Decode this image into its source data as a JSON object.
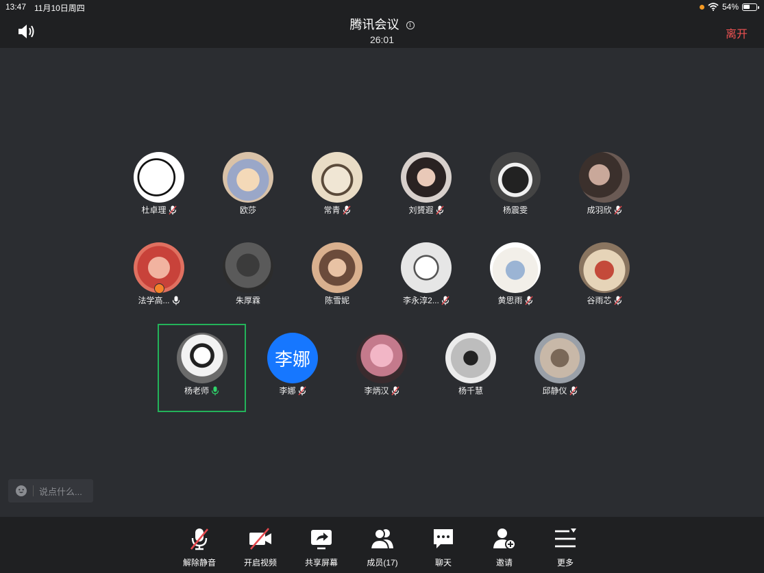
{
  "status_bar": {
    "time": "13:47",
    "date": "11月10日周四",
    "battery": "54%",
    "battery_level": 0.54
  },
  "header": {
    "title": "腾讯会议",
    "timer": "26:01",
    "leave_label": "离开"
  },
  "participants": [
    {
      "name": "杜卓理",
      "mic": "muted"
    },
    {
      "name": "欧莎",
      "mic": "none"
    },
    {
      "name": "常青",
      "mic": "muted"
    },
    {
      "name": "刘贇遐",
      "mic": "muted"
    },
    {
      "name": "杨震雯",
      "mic": "none"
    },
    {
      "name": "成羽欣",
      "mic": "muted"
    },
    {
      "name": "法学高...",
      "mic": "on",
      "host": true
    },
    {
      "name": "朱厚霖",
      "mic": "none"
    },
    {
      "name": "陈雪妮",
      "mic": "none"
    },
    {
      "name": "李永淳2...",
      "mic": "muted"
    },
    {
      "name": "黄思雨",
      "mic": "muted"
    },
    {
      "name": "谷雨芯",
      "mic": "muted"
    },
    {
      "name": "杨老师",
      "mic": "speaking",
      "active": true
    },
    {
      "name": "李娜",
      "mic": "muted",
      "initials": "李娜"
    },
    {
      "name": "李炳汉",
      "mic": "muted"
    },
    {
      "name": "杨千慧",
      "mic": "none"
    },
    {
      "name": "邱静仪",
      "mic": "muted"
    }
  ],
  "chat": {
    "placeholder": "说点什么..."
  },
  "toolbar": [
    {
      "label": "解除静音",
      "icon": "mic-muted-icon"
    },
    {
      "label": "开启视频",
      "icon": "video-off-icon"
    },
    {
      "label": "共享屏幕",
      "icon": "share-screen-icon"
    },
    {
      "label": "成员(17)",
      "icon": "members-icon"
    },
    {
      "label": "聊天",
      "icon": "chat-icon"
    },
    {
      "label": "邀请",
      "icon": "invite-icon"
    },
    {
      "label": "更多",
      "icon": "more-icon"
    }
  ],
  "colors": {
    "accent_green": "#23b35a",
    "leave_red": "#f05252",
    "avatar_blue": "#1677ff"
  }
}
